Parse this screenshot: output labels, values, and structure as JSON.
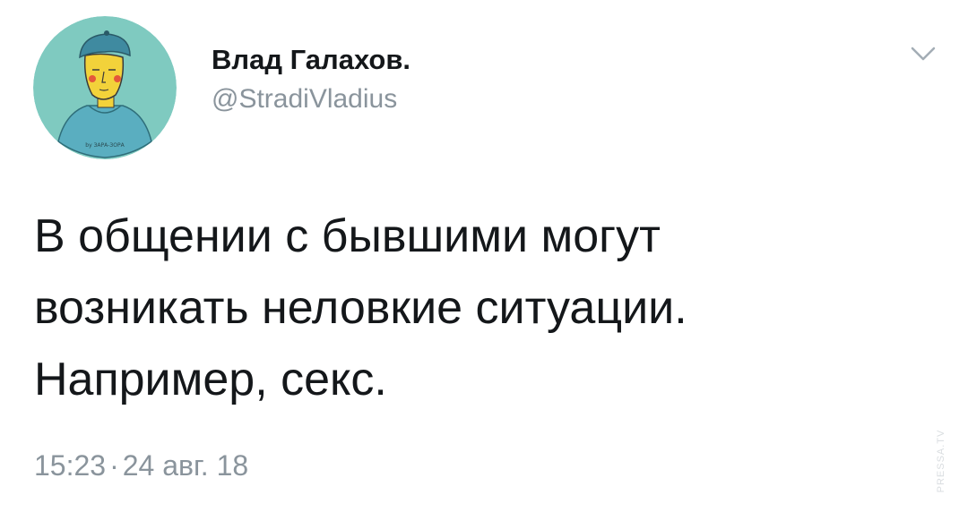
{
  "tweet": {
    "author": {
      "display_name": "Влад Галахов.",
      "handle": "@StradiVladius",
      "avatar_signature": "by ЗАРА-ЗОРА"
    },
    "text": "В общении с бывшими могут\nвозникать неловкие ситуации.\nНапример, секс.",
    "time": "15:23",
    "separator": "·",
    "date": "24 авг. 18",
    "menu_icon": "chevron-down-icon"
  },
  "watermark": "PRESSA.TV",
  "colors": {
    "text": "#14171a",
    "secondary": "#8a949c",
    "avatar_bg": "#7fcac0",
    "background": "#ffffff"
  }
}
